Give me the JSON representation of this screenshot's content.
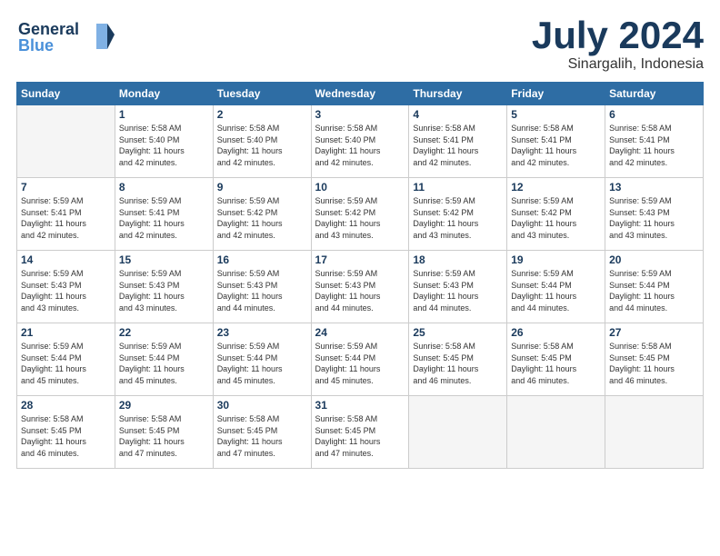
{
  "header": {
    "logo_line1": "General",
    "logo_line2": "Blue",
    "month": "July 2024",
    "location": "Sinargalih, Indonesia"
  },
  "weekdays": [
    "Sunday",
    "Monday",
    "Tuesday",
    "Wednesday",
    "Thursday",
    "Friday",
    "Saturday"
  ],
  "weeks": [
    [
      {
        "day": "",
        "info": ""
      },
      {
        "day": "1",
        "info": "Sunrise: 5:58 AM\nSunset: 5:40 PM\nDaylight: 11 hours\nand 42 minutes."
      },
      {
        "day": "2",
        "info": "Sunrise: 5:58 AM\nSunset: 5:40 PM\nDaylight: 11 hours\nand 42 minutes."
      },
      {
        "day": "3",
        "info": "Sunrise: 5:58 AM\nSunset: 5:40 PM\nDaylight: 11 hours\nand 42 minutes."
      },
      {
        "day": "4",
        "info": "Sunrise: 5:58 AM\nSunset: 5:41 PM\nDaylight: 11 hours\nand 42 minutes."
      },
      {
        "day": "5",
        "info": "Sunrise: 5:58 AM\nSunset: 5:41 PM\nDaylight: 11 hours\nand 42 minutes."
      },
      {
        "day": "6",
        "info": "Sunrise: 5:58 AM\nSunset: 5:41 PM\nDaylight: 11 hours\nand 42 minutes."
      }
    ],
    [
      {
        "day": "7",
        "info": "Sunrise: 5:59 AM\nSunset: 5:41 PM\nDaylight: 11 hours\nand 42 minutes."
      },
      {
        "day": "8",
        "info": "Sunrise: 5:59 AM\nSunset: 5:41 PM\nDaylight: 11 hours\nand 42 minutes."
      },
      {
        "day": "9",
        "info": "Sunrise: 5:59 AM\nSunset: 5:42 PM\nDaylight: 11 hours\nand 42 minutes."
      },
      {
        "day": "10",
        "info": "Sunrise: 5:59 AM\nSunset: 5:42 PM\nDaylight: 11 hours\nand 43 minutes."
      },
      {
        "day": "11",
        "info": "Sunrise: 5:59 AM\nSunset: 5:42 PM\nDaylight: 11 hours\nand 43 minutes."
      },
      {
        "day": "12",
        "info": "Sunrise: 5:59 AM\nSunset: 5:42 PM\nDaylight: 11 hours\nand 43 minutes."
      },
      {
        "day": "13",
        "info": "Sunrise: 5:59 AM\nSunset: 5:43 PM\nDaylight: 11 hours\nand 43 minutes."
      }
    ],
    [
      {
        "day": "14",
        "info": "Sunrise: 5:59 AM\nSunset: 5:43 PM\nDaylight: 11 hours\nand 43 minutes."
      },
      {
        "day": "15",
        "info": "Sunrise: 5:59 AM\nSunset: 5:43 PM\nDaylight: 11 hours\nand 43 minutes."
      },
      {
        "day": "16",
        "info": "Sunrise: 5:59 AM\nSunset: 5:43 PM\nDaylight: 11 hours\nand 44 minutes."
      },
      {
        "day": "17",
        "info": "Sunrise: 5:59 AM\nSunset: 5:43 PM\nDaylight: 11 hours\nand 44 minutes."
      },
      {
        "day": "18",
        "info": "Sunrise: 5:59 AM\nSunset: 5:43 PM\nDaylight: 11 hours\nand 44 minutes."
      },
      {
        "day": "19",
        "info": "Sunrise: 5:59 AM\nSunset: 5:44 PM\nDaylight: 11 hours\nand 44 minutes."
      },
      {
        "day": "20",
        "info": "Sunrise: 5:59 AM\nSunset: 5:44 PM\nDaylight: 11 hours\nand 44 minutes."
      }
    ],
    [
      {
        "day": "21",
        "info": "Sunrise: 5:59 AM\nSunset: 5:44 PM\nDaylight: 11 hours\nand 45 minutes."
      },
      {
        "day": "22",
        "info": "Sunrise: 5:59 AM\nSunset: 5:44 PM\nDaylight: 11 hours\nand 45 minutes."
      },
      {
        "day": "23",
        "info": "Sunrise: 5:59 AM\nSunset: 5:44 PM\nDaylight: 11 hours\nand 45 minutes."
      },
      {
        "day": "24",
        "info": "Sunrise: 5:59 AM\nSunset: 5:44 PM\nDaylight: 11 hours\nand 45 minutes."
      },
      {
        "day": "25",
        "info": "Sunrise: 5:58 AM\nSunset: 5:45 PM\nDaylight: 11 hours\nand 46 minutes."
      },
      {
        "day": "26",
        "info": "Sunrise: 5:58 AM\nSunset: 5:45 PM\nDaylight: 11 hours\nand 46 minutes."
      },
      {
        "day": "27",
        "info": "Sunrise: 5:58 AM\nSunset: 5:45 PM\nDaylight: 11 hours\nand 46 minutes."
      }
    ],
    [
      {
        "day": "28",
        "info": "Sunrise: 5:58 AM\nSunset: 5:45 PM\nDaylight: 11 hours\nand 46 minutes."
      },
      {
        "day": "29",
        "info": "Sunrise: 5:58 AM\nSunset: 5:45 PM\nDaylight: 11 hours\nand 47 minutes."
      },
      {
        "day": "30",
        "info": "Sunrise: 5:58 AM\nSunset: 5:45 PM\nDaylight: 11 hours\nand 47 minutes."
      },
      {
        "day": "31",
        "info": "Sunrise: 5:58 AM\nSunset: 5:45 PM\nDaylight: 11 hours\nand 47 minutes."
      },
      {
        "day": "",
        "info": ""
      },
      {
        "day": "",
        "info": ""
      },
      {
        "day": "",
        "info": ""
      }
    ]
  ]
}
